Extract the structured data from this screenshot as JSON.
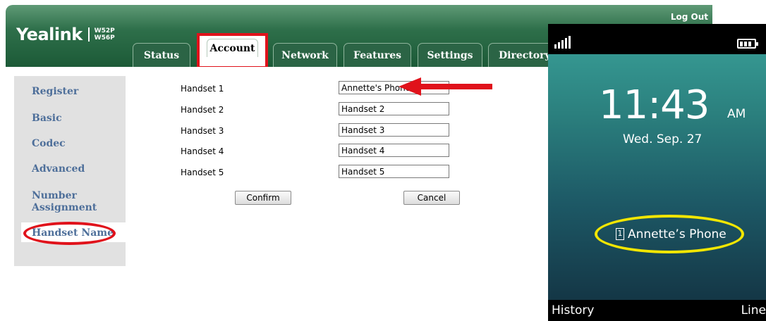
{
  "web": {
    "logout": "Log Out",
    "logo": {
      "brand": "Yealink",
      "model_1": "W52P",
      "model_2": "W56P"
    },
    "tabs": [
      {
        "label": "Status"
      },
      {
        "label": "Account",
        "active": true
      },
      {
        "label": "Network"
      },
      {
        "label": "Features"
      },
      {
        "label": "Settings"
      },
      {
        "label": "Directory"
      }
    ],
    "sidebar": {
      "items": [
        {
          "label": "Register"
        },
        {
          "label": "Basic"
        },
        {
          "label": "Codec"
        },
        {
          "label": "Advanced"
        },
        {
          "label": "Number Assignment"
        },
        {
          "label": "Handset Name",
          "active": true
        }
      ]
    },
    "form": {
      "rows": [
        {
          "label": "Handset 1",
          "value": "Annette's Phone"
        },
        {
          "label": "Handset 2",
          "value": "Handset 2"
        },
        {
          "label": "Handset 3",
          "value": "Handset 3"
        },
        {
          "label": "Handset 4",
          "value": "Handset 4"
        },
        {
          "label": "Handset 5",
          "value": "Handset 5"
        }
      ],
      "confirm_label": "Confirm",
      "cancel_label": "Cancel"
    }
  },
  "phone": {
    "time": "11:43",
    "ampm": "AM",
    "date": "Wed. Sep. 27",
    "handset_number": "1",
    "handset_name": "Annette’s Phone",
    "softkey_left": "History",
    "softkey_right": "Line"
  },
  "colors": {
    "header_green": "#1c5a37",
    "highlight_red": "#e0121b",
    "highlight_yellow": "#f2e600",
    "sidebar_link": "#4e6f9a"
  }
}
